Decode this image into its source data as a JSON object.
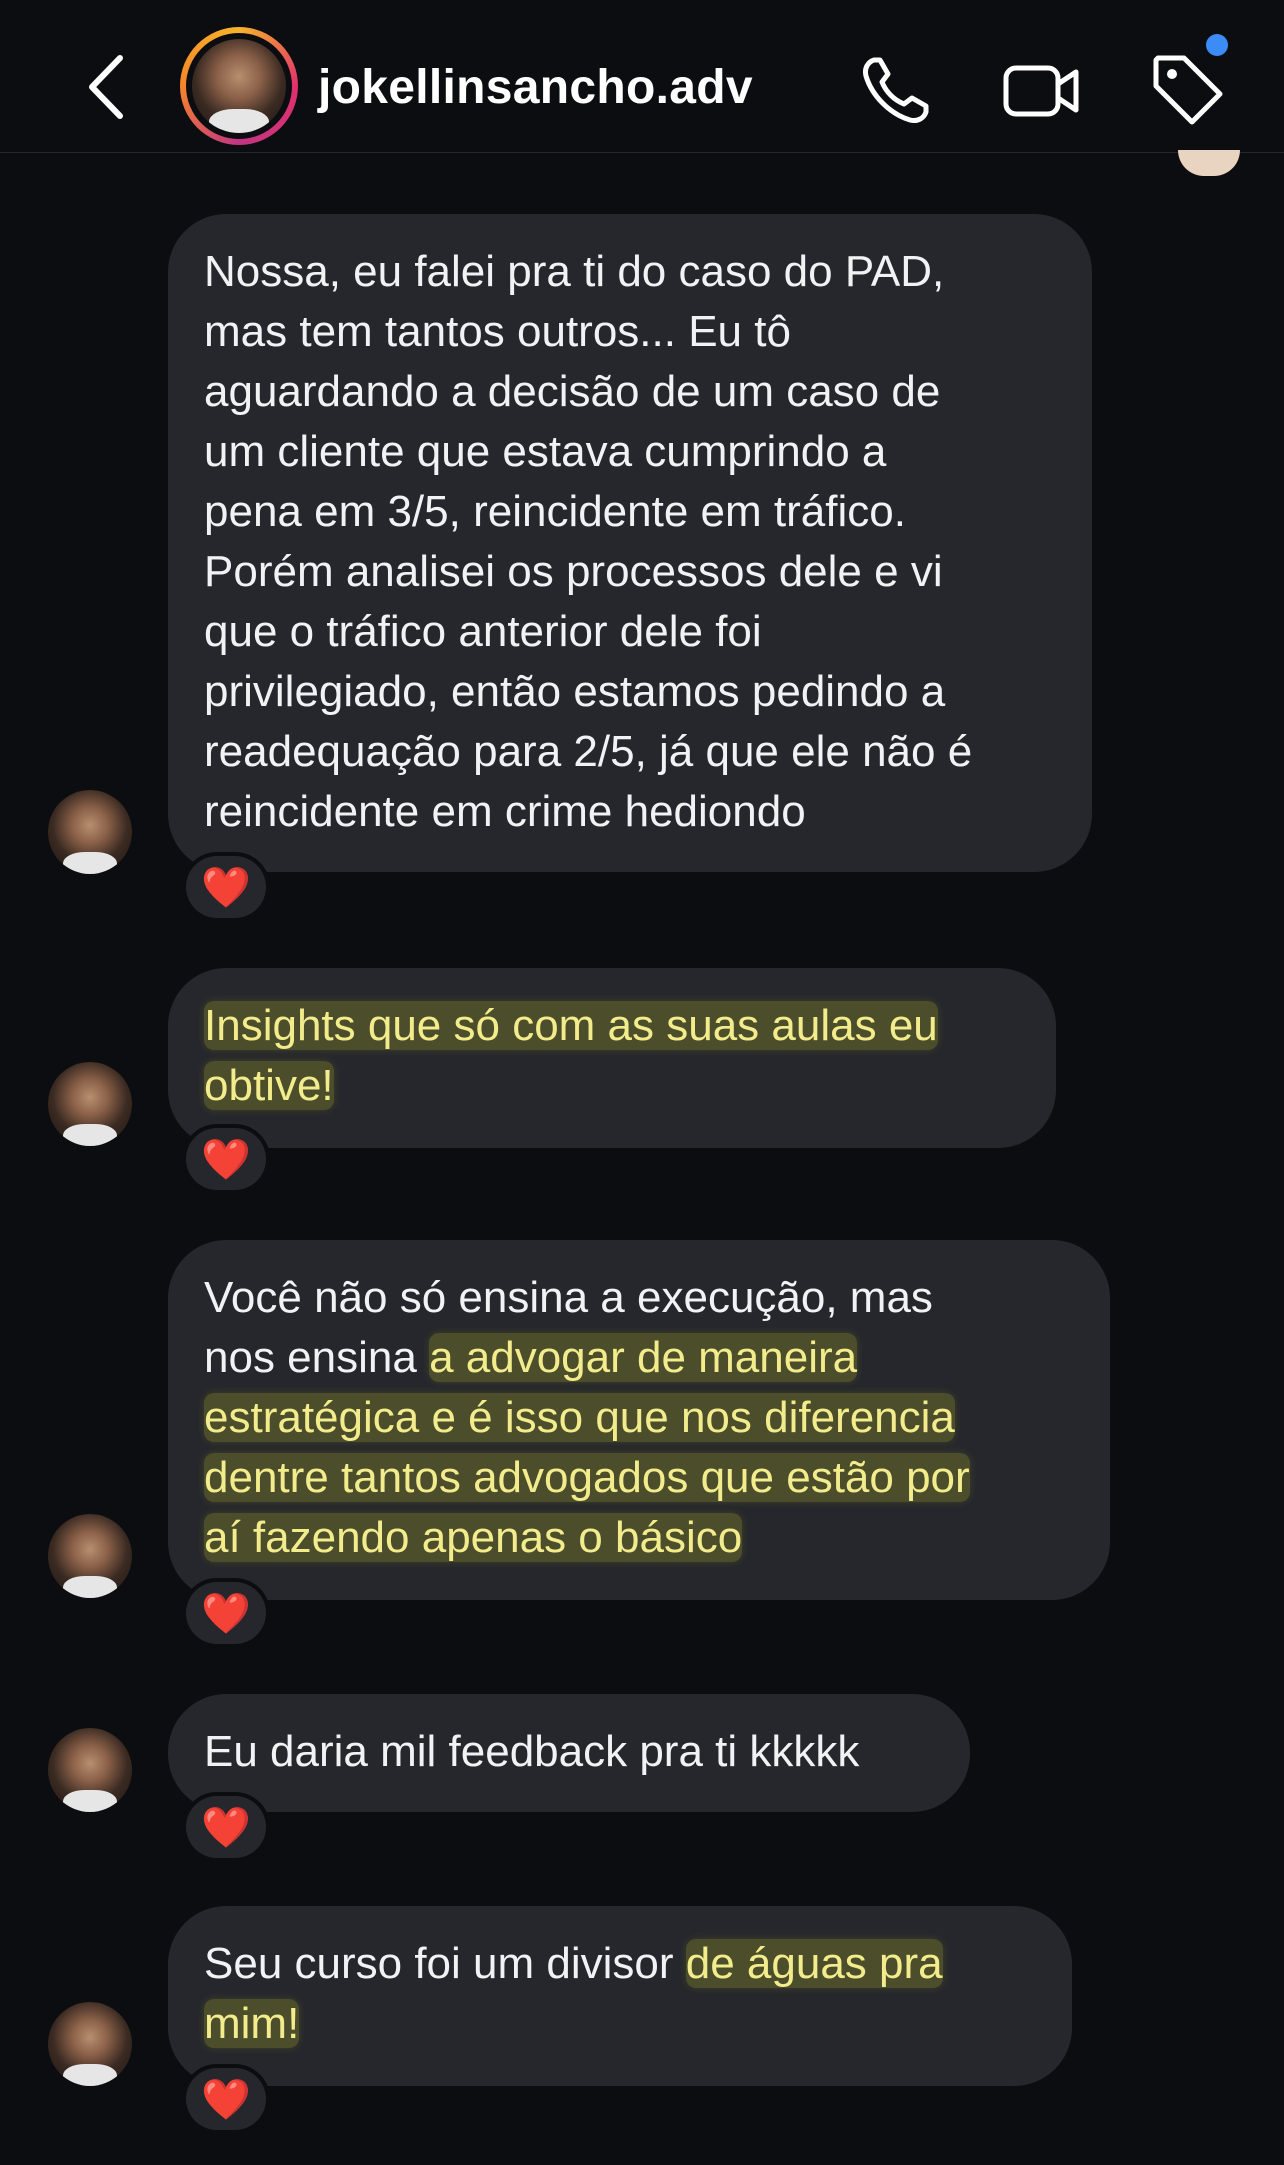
{
  "header": {
    "username": "jokellinsancho.adv",
    "icons": [
      "back-chevron-icon",
      "phone-icon",
      "video-camera-icon",
      "tag-icon"
    ],
    "notification_dot_color": "#3b8cf6"
  },
  "messages": [
    {
      "lines": [
        "Nossa, eu falei pra ti do caso do PAD,",
        "mas tem tantos outros... Eu tô",
        "aguardando a decisão de um caso de",
        "um cliente que estava cumprindo a",
        "pena em 3/5, reincidente em tráfico.",
        "Porém analisei os processos dele e vi",
        "que o tráfico anterior dele foi",
        "privilegiado, então estamos pedindo a",
        "readequação para 2/5, já que ele não é",
        "reincidente em crime hediondo"
      ],
      "reaction": "❤️"
    },
    {
      "lines": [
        "Insights que só com as suas aulas eu",
        "obtive!"
      ],
      "reaction": "❤️"
    },
    {
      "lines_plain": [
        "Você não só ensina a execução, mas",
        "nos ensina "
      ],
      "lines_highlight": [
        "a advogar de maneira",
        "estratégica e é isso que nos diferencia",
        "dentre tantos advogados que estão por",
        "aí fazendo apenas o básico"
      ],
      "reaction": "❤️"
    },
    {
      "lines": [
        "Eu daria mil feedback pra ti kkkkk"
      ],
      "reaction": "❤️"
    },
    {
      "plain": "Seu curso foi um divisor ",
      "highlight_1": "de águas pra",
      "highlight_2": "mim!",
      "reaction": "❤️"
    }
  ],
  "colors": {
    "background": "#0c0d10",
    "bubble": "#26272c",
    "highlight_text": "#f2ec8c",
    "heart": "#e8332f"
  }
}
